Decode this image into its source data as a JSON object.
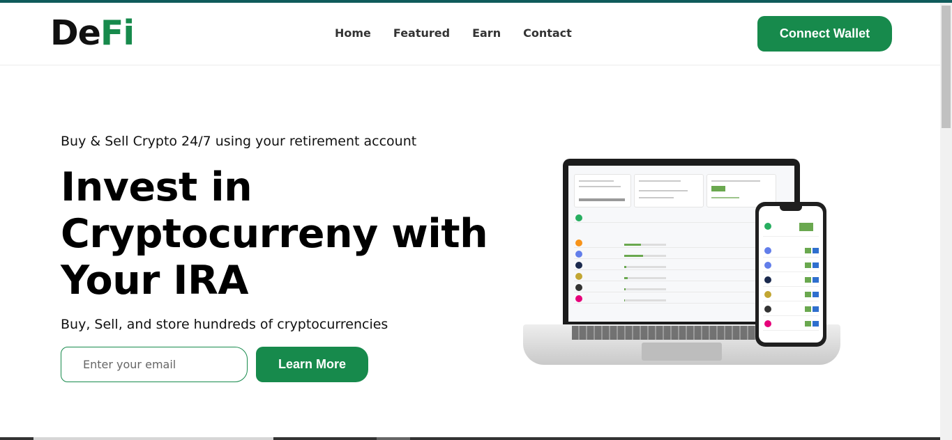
{
  "brand": {
    "logo_part1": "De",
    "logo_part2": "Fi",
    "accent_color": "#178a4c",
    "top_strip_color": "#0f5b5b"
  },
  "nav": {
    "links": [
      {
        "label": "Home"
      },
      {
        "label": "Featured"
      },
      {
        "label": "Earn"
      },
      {
        "label": "Contact"
      }
    ],
    "connect_label": "Connect Wallet"
  },
  "hero": {
    "subtitle": "Buy & Sell Crypto 24/7 using your retirement account",
    "title": "Invest in Cryptocurreny with Your IRA",
    "description": "Buy, Sell, and store hundreds of cryptocurrencies",
    "email_placeholder": "Enter your email",
    "cta_label": "Learn More"
  },
  "mockup": {
    "laptop_icon": "laptop-dashboard-image",
    "phone_icon": "phone-dashboard-image",
    "coin_colors": [
      "#f7931a",
      "#627eea",
      "#1b2a4e",
      "#c2a633",
      "#333333",
      "#e6007a"
    ]
  }
}
